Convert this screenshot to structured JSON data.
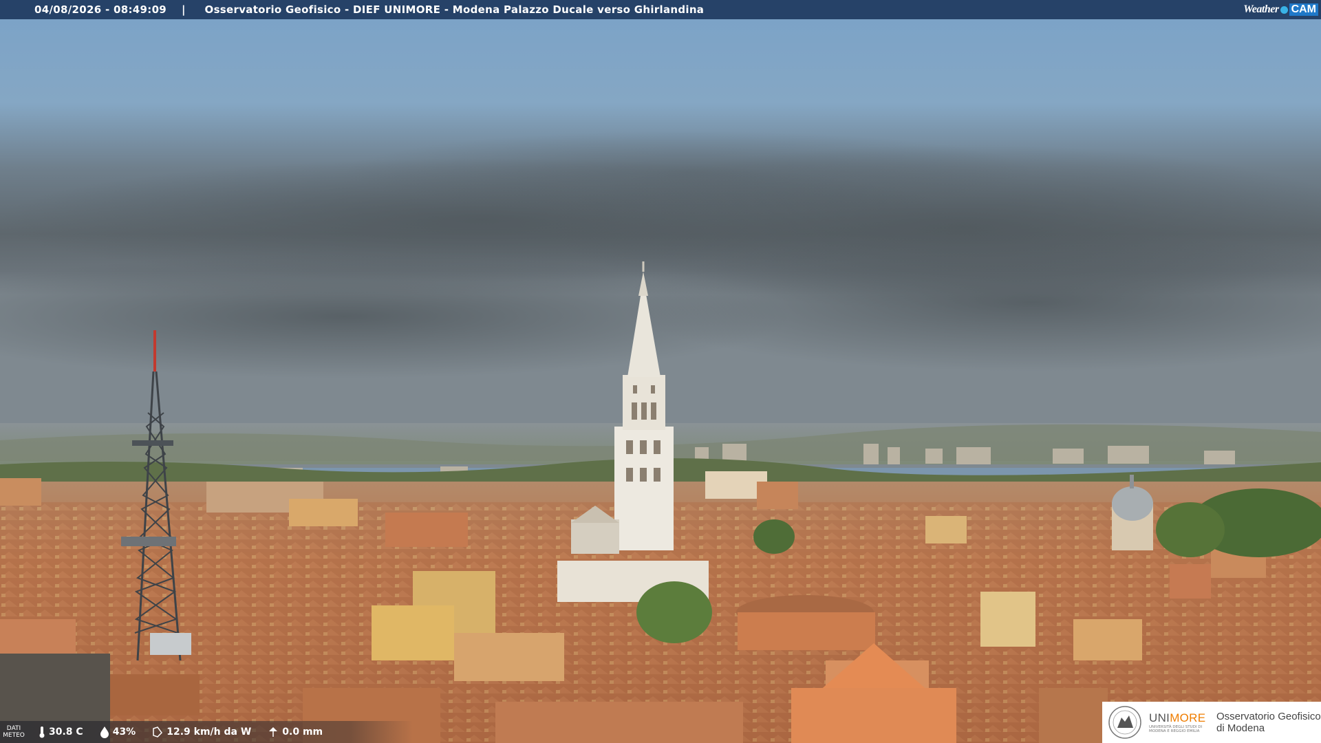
{
  "overlay": {
    "timestamp": "04/08/2026 - 08:49:09",
    "separator": "|",
    "location": "Osservatorio Geofisico - DIEF UNIMORE - Modena Palazzo Ducale verso Ghirlandina"
  },
  "branding": {
    "weathercam_w": "Weather",
    "weathercam_cam": "CAM"
  },
  "weather_data": {
    "label": "DATI METEO",
    "temperature": "30.8 C",
    "humidity": "43%",
    "wind": "12.9 km/h da W",
    "rain": "0.0 mm"
  },
  "logo": {
    "uni_prefix": "UNI",
    "uni_suffix": "MORE",
    "uni_subtitle": "UNIVERSITÀ DEGLI STUDI DI MODENA E REGGIO EMILIA",
    "observatory_line1": "Osservatorio Geofisico",
    "observatory_line2": "di Modena"
  },
  "colors": {
    "topbar": "#1e3a60",
    "sky_top": "#7aa2c8",
    "sky_cloud": "#5d6870",
    "roof": "#b8744d",
    "tower": "#e6e2d6",
    "unimore_orange": "#ef7d00"
  }
}
